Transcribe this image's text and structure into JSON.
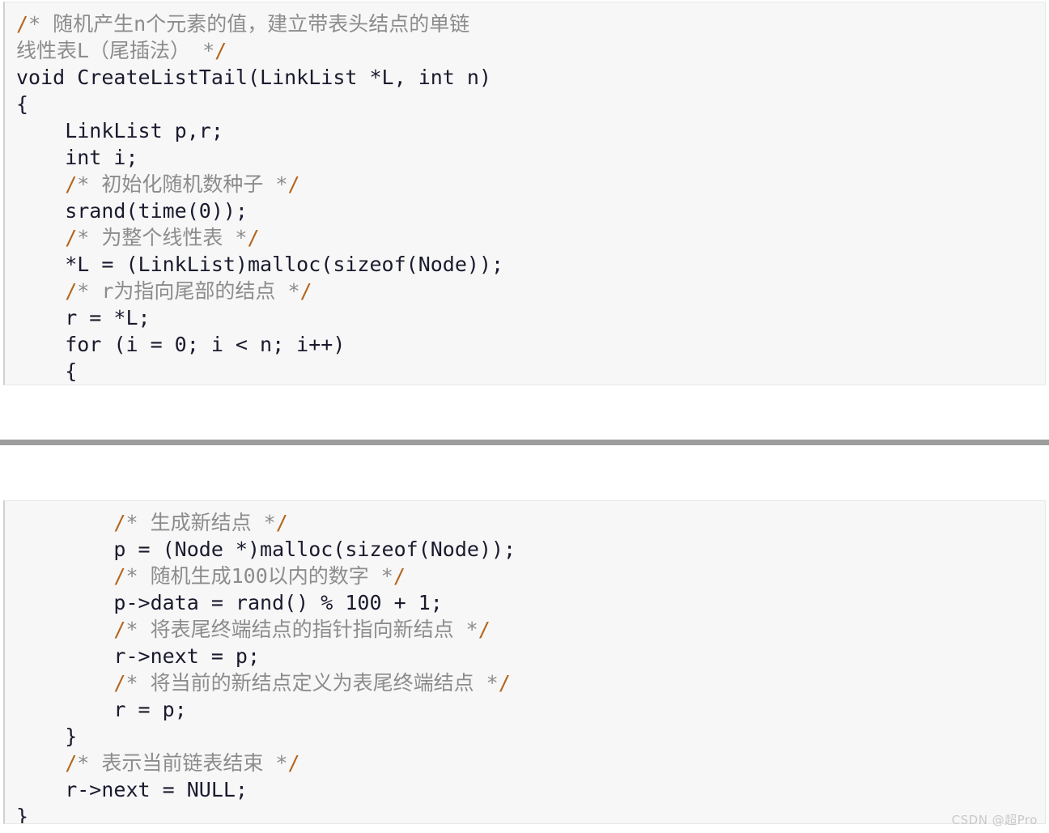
{
  "document": {
    "type": "code-snippet-screenshot",
    "language": "C",
    "background_color": "#ffffff",
    "code_background_color": "#f7f7f7",
    "code_text_color": "#1a1a2e",
    "comment_text_color": "#8c8c8c",
    "punctuation_accent_color": "#b5651d",
    "separator_color": "#9e9e9e"
  },
  "code_block_1": {
    "lines": [
      "/* 随机产生n个元素的值，建立带表头结点的单链",
      "线性表L（尾插法） */",
      "void CreateListTail(LinkList *L, int n)",
      "{",
      "    LinkList p,r;",
      "    int i;",
      "    /* 初始化随机数种子 */",
      "    srand(time(0));",
      "    /* 为整个线性表 */",
      "    *L = (LinkList)malloc(sizeof(Node));",
      "    /* r为指向尾部的结点 */",
      "    r = *L;",
      "    for (i = 0; i < n; i++)",
      "    {"
    ],
    "comment_flags": [
      true,
      true,
      false,
      false,
      false,
      false,
      true,
      false,
      true,
      false,
      true,
      false,
      false,
      false
    ]
  },
  "code_block_2": {
    "lines": [
      "        /* 生成新结点 */",
      "        p = (Node *)malloc(sizeof(Node));",
      "        /* 随机生成100以内的数字 */",
      "        p->data = rand() % 100 + 1;",
      "        /* 将表尾终端结点的指针指向新结点 */",
      "        r->next = p;",
      "        /* 将当前的新结点定义为表尾终端结点 */",
      "        r = p;",
      "    }",
      "    /* 表示当前链表结束 */",
      "    r->next = NULL;",
      "}"
    ],
    "comment_flags": [
      true,
      false,
      true,
      false,
      true,
      false,
      true,
      false,
      false,
      true,
      false,
      false
    ]
  },
  "watermark": {
    "text": "CSDN @超Pro"
  }
}
